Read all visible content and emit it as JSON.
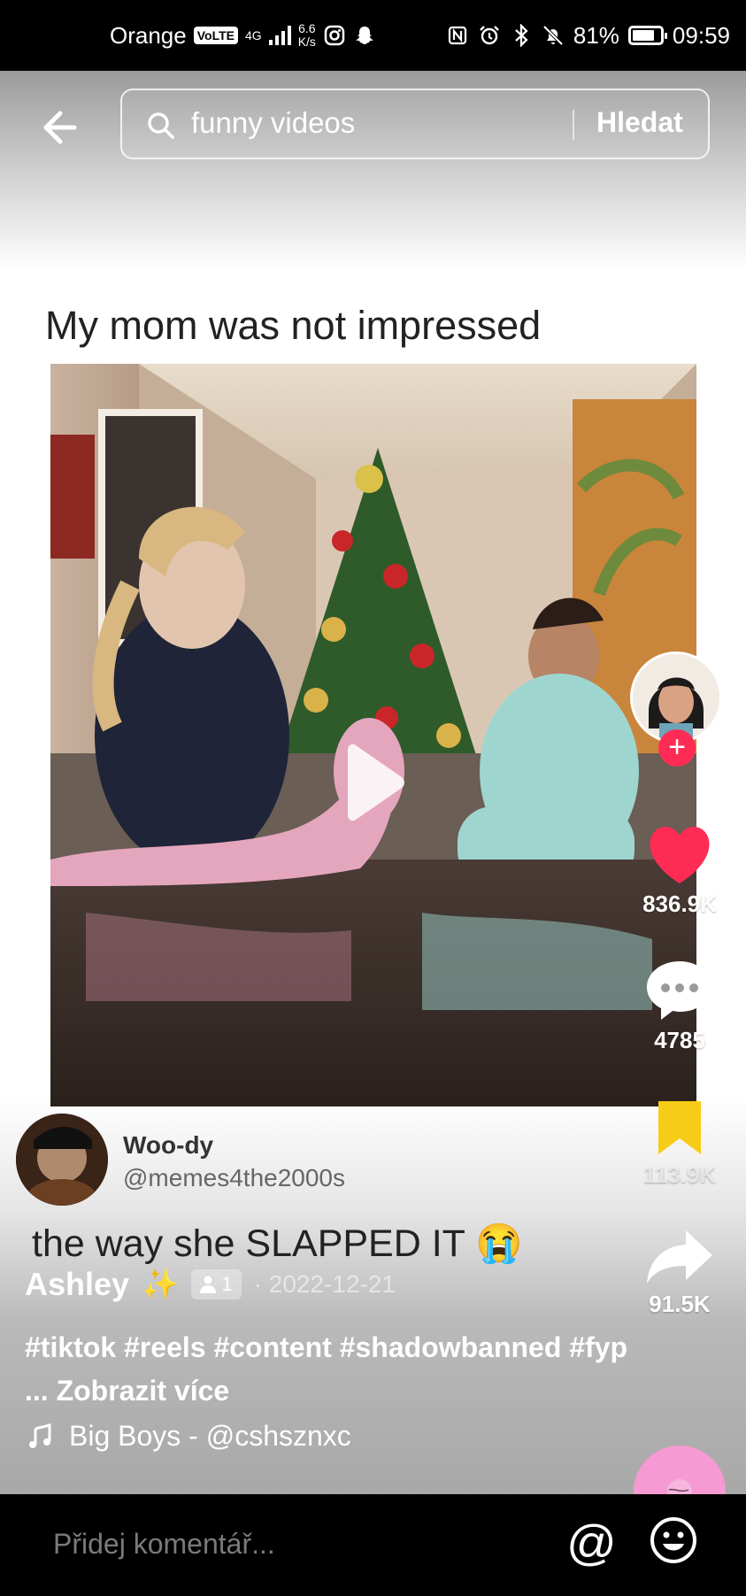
{
  "status_bar": {
    "carrier": "Orange",
    "volte": "VoLTE",
    "network": "4G",
    "speed_value": "6.6",
    "speed_unit": "K/s",
    "battery": "81%",
    "battery_level": 0.81,
    "time": "09:59"
  },
  "search": {
    "query": "funny videos",
    "button_label": "Hledat"
  },
  "video": {
    "caption": "My mom was not impressed"
  },
  "video_user": {
    "name": "Woo-dy",
    "handle": "@memes4the2000s"
  },
  "post": {
    "description": "the way she SLAPPED IT 😭",
    "author": "Ashley",
    "friends_count": "1",
    "date": "· 2022-12-21",
    "hashtags": "#tiktok #reels #content #shadowbanned #fyp ...",
    "more_label": "Zobrazit více",
    "music": "Big Boys - @cshsznxc"
  },
  "actions": {
    "likes": "836.9K",
    "comments": "4785",
    "saves": "113.9K",
    "shares": "91.5K"
  },
  "comment_bar": {
    "placeholder": "Přidej komentář..."
  },
  "colors": {
    "like": "#fe2c55",
    "bookmark": "#f7cc16",
    "disc": "#f59ad2"
  }
}
